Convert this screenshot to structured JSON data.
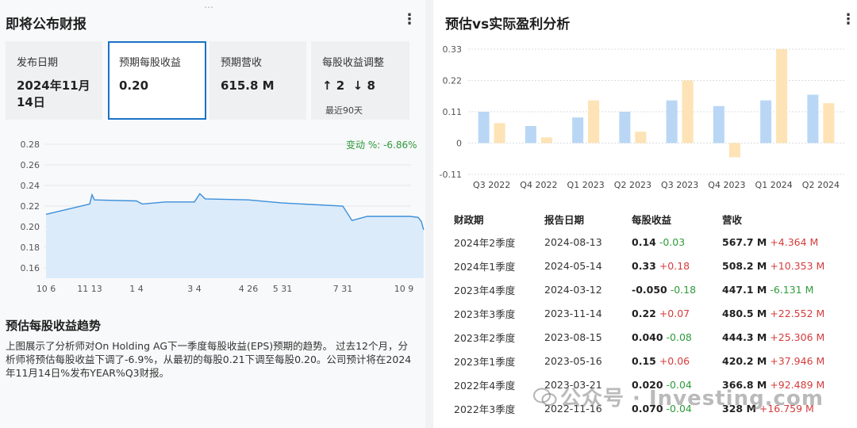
{
  "left": {
    "title": "即将公布财报",
    "menu_icon": "⋮",
    "drag_handle": "⋯",
    "cards": [
      {
        "label": "发布日期",
        "value": "2024年11月\n14日",
        "sub": ""
      },
      {
        "label": "预期每股收益",
        "value": "0.20",
        "sub": ""
      },
      {
        "label": "预期营收",
        "value": "615.8 M",
        "sub": ""
      },
      {
        "label": "每股收益调整",
        "value": "↑ 2  ↓ 8",
        "sub": "最近90天"
      }
    ],
    "eps_change": "变动 %: -6.86%",
    "trend_heading": "预估每股收益趋势",
    "trend_desc": "上图展示了分析师对On Holding AG下一季度每股收益(EPS)预期的趋势。 过去12个月，分析师将预估每股收益下调了-6.9%，从最初的每股0.21下调至每股0.20。公司预计将在2024年11月14日%发布YEAR%Q3财报。"
  },
  "right": {
    "title": "预估vs实际盈利分析",
    "menu_icon": "⋮",
    "table": {
      "headers": [
        "财政期",
        "报告日期",
        "每股收益",
        "营收"
      ],
      "rows": [
        {
          "period": "2024年2季度",
          "date": "2024-08-13",
          "eps": "0.14",
          "eps_diff": "-0.03",
          "eps_dir": "neg",
          "rev": "567.7 M",
          "rev_diff": "+4.364 M",
          "rev_dir": "pos"
        },
        {
          "period": "2024年1季度",
          "date": "2024-05-14",
          "eps": "0.33",
          "eps_diff": "+0.18",
          "eps_dir": "pos",
          "rev": "508.2 M",
          "rev_diff": "+10.353 M",
          "rev_dir": "pos"
        },
        {
          "period": "2023年4季度",
          "date": "2024-03-12",
          "eps": "-0.050",
          "eps_diff": "-0.18",
          "eps_dir": "neg",
          "rev": "447.1 M",
          "rev_diff": "-6.131 M",
          "rev_dir": "neg"
        },
        {
          "period": "2023年3季度",
          "date": "2023-11-14",
          "eps": "0.22",
          "eps_diff": "+0.07",
          "eps_dir": "pos",
          "rev": "480.5 M",
          "rev_diff": "+22.552 M",
          "rev_dir": "pos"
        },
        {
          "period": "2023年2季度",
          "date": "2023-08-15",
          "eps": "0.040",
          "eps_diff": "-0.08",
          "eps_dir": "neg",
          "rev": "444.3 M",
          "rev_diff": "+25.306 M",
          "rev_dir": "pos"
        },
        {
          "period": "2023年1季度",
          "date": "2023-05-16",
          "eps": "0.15",
          "eps_diff": "+0.06",
          "eps_dir": "pos",
          "rev": "420.2 M",
          "rev_diff": "+37.946 M",
          "rev_dir": "pos"
        },
        {
          "period": "2022年4季度",
          "date": "2023-03-21",
          "eps": "0.020",
          "eps_diff": "-0.04",
          "eps_dir": "neg",
          "rev": "366.8 M",
          "rev_diff": "+92.489 M",
          "rev_dir": "pos"
        },
        {
          "period": "2022年3季度",
          "date": "2022-11-16",
          "eps": "0.070",
          "eps_diff": "-0.04",
          "eps_dir": "neg",
          "rev": "328 M",
          "rev_diff": "+16.759 M",
          "rev_dir": "pos"
        }
      ]
    }
  },
  "watermark": "公众号 · Investing.com",
  "colors": {
    "accent_blue": "#1a73c8",
    "estimate_bar": "#b9d7f5",
    "actual_bar": "#fde3b5",
    "positive": "#d43c3c",
    "negative": "#2f9b3b",
    "trend_line": "#3b8fd9",
    "trend_fill": "#dcebfa"
  },
  "chart_data": [
    {
      "type": "area",
      "title": "",
      "x_tick_labels": [
        "10 6",
        "11 13",
        "1 4",
        "3 4",
        "4 26",
        "5 31",
        "7 31",
        "10 9"
      ],
      "ylim": [
        0.15,
        0.28
      ],
      "y_ticks": [
        0.28,
        0.26,
        0.24,
        0.22,
        0.2,
        0.18,
        0.16
      ],
      "grid": "horizontal",
      "series": [
        {
          "points": [
            [
              0,
              0.212
            ],
            [
              1,
              0.222
            ],
            [
              1.05,
              0.231
            ],
            [
              1.1,
              0.226
            ],
            [
              2,
              0.225
            ],
            [
              2.1,
              0.222
            ],
            [
              2.5,
              0.224
            ],
            [
              3.0,
              0.224
            ],
            [
              3.1,
              0.232
            ],
            [
              3.2,
              0.227
            ],
            [
              4.0,
              0.226
            ],
            [
              5.0,
              0.223
            ],
            [
              6.0,
              0.22
            ],
            [
              6.15,
              0.206
            ],
            [
              6.4,
              0.21
            ],
            [
              7.2,
              0.21
            ],
            [
              7.45,
              0.209
            ],
            [
              7.55,
              0.205
            ],
            [
              7.62,
              0.197
            ]
          ]
        }
      ]
    },
    {
      "type": "bar",
      "title": "",
      "categories": [
        "Q3 2022",
        "Q4 2022",
        "Q1 2023",
        "Q2 2023",
        "Q3 2023",
        "Q4 2023",
        "Q1 2024",
        "Q2 2024"
      ],
      "series": [
        {
          "values": [
            0.11,
            0.06,
            0.09,
            0.11,
            0.15,
            0.13,
            0.15,
            0.17
          ]
        },
        {
          "values": [
            0.07,
            0.02,
            0.15,
            0.04,
            0.22,
            -0.05,
            0.33,
            0.14
          ]
        }
      ],
      "ylim": [
        -0.11,
        0.33
      ],
      "y_ticks": [
        0.33,
        0.22,
        0.11,
        0,
        -0.11
      ],
      "grid": "horizontal-dashed"
    }
  ]
}
